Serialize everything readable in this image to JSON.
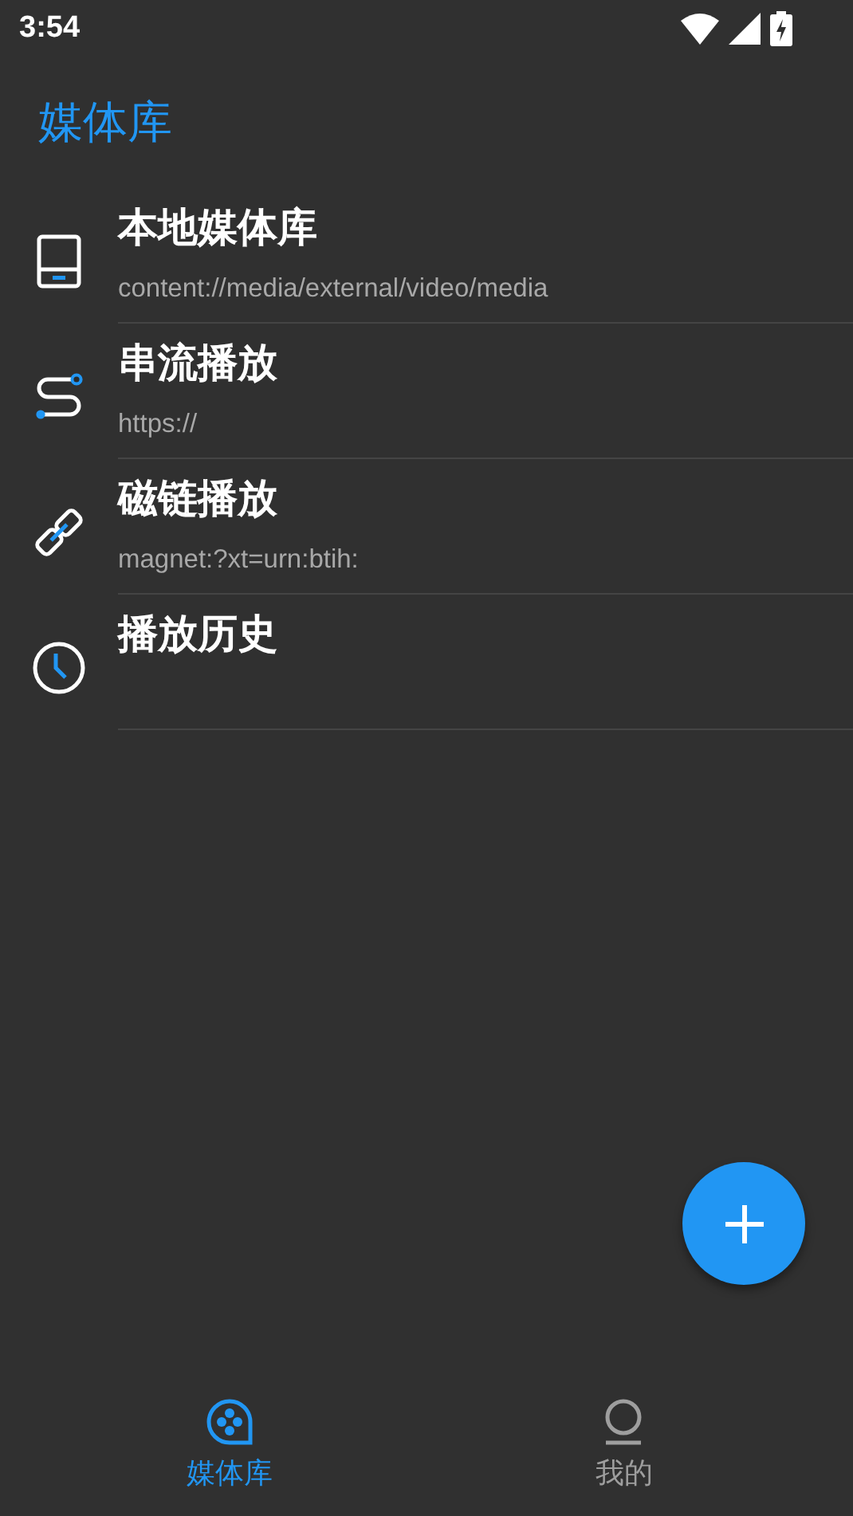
{
  "status_bar": {
    "time": "3:54"
  },
  "header": {
    "title": "媒体库"
  },
  "items": [
    {
      "kind": "device",
      "title": "本地媒体库",
      "subtitle": "content://media/external/video/media"
    },
    {
      "kind": "stream",
      "title": "串流播放",
      "subtitle": "https://"
    },
    {
      "kind": "link",
      "title": "磁链播放",
      "subtitle": "magnet:?xt=urn:btih:"
    },
    {
      "kind": "history",
      "title": "播放历史"
    }
  ],
  "fab": {
    "kind": "add"
  },
  "bottom_nav": [
    {
      "kind": "media",
      "label": "媒体库",
      "selected": true
    },
    {
      "kind": "profile",
      "label": "我的",
      "selected": false
    }
  ]
}
